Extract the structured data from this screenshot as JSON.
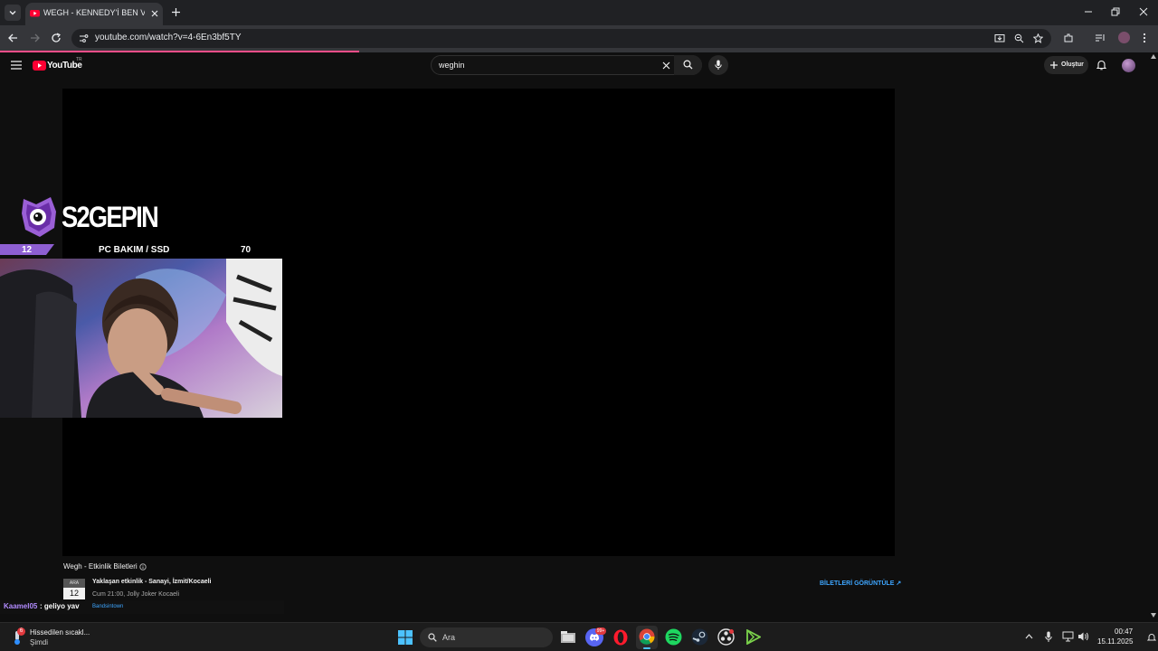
{
  "browser": {
    "tab_title": "WEGH - KENNEDY'İ BEN VURDUM",
    "url": "youtube.com/watch?v=4-6En3bf5TY",
    "loading_progress": 0.31
  },
  "youtube": {
    "logo_text": "YouTube",
    "region": "TR",
    "search_value": "weghin",
    "create_label": "Oluştur"
  },
  "overlay": {
    "brand": "S2GEPIN",
    "badge_number": "12",
    "promo_text": "PC BAKIM / SSD",
    "promo_number": "70"
  },
  "tickets": {
    "title": "Wegh - Etkinlik Biletleri",
    "date_month": "ARA",
    "date_day": "12",
    "event_title": "Yaklaşan etkinlik - Sanayi, İzmit/Kocaeli",
    "event_details": "Cum 21:00, Jolly Joker Kocaeli",
    "provider": "Bandsintown",
    "cta": "BİLETLERİ GÖRÜNTÜLE ↗"
  },
  "chat": {
    "user": "Kaamel05",
    "message": ": geliyo yav"
  },
  "taskbar": {
    "weather_title": "Hissedilen sıcakl...",
    "weather_sub": "Şimdi",
    "weather_badge": "6",
    "search_label": "Ara",
    "discord_badge": "99+",
    "time": "00:47",
    "date": "15.11.2025"
  },
  "colors": {
    "youtube_red": "#ff0033",
    "accent_purple": "#8e5fd2",
    "link_blue": "#3ea6ff",
    "chat_user": "#b28cff"
  }
}
